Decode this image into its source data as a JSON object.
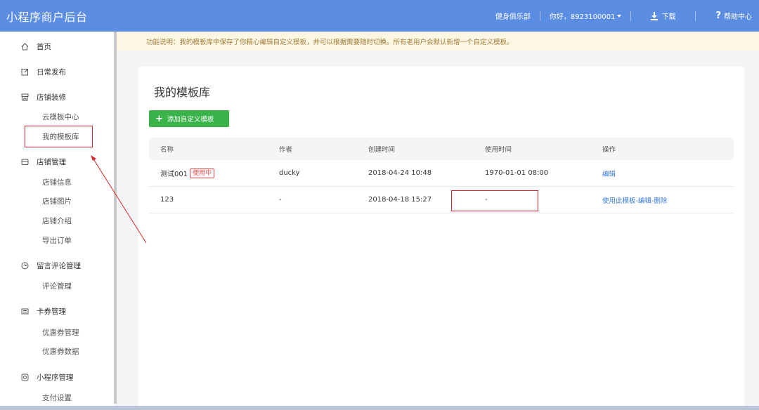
{
  "header": {
    "brand": "小程序商户后台",
    "shop_name": "健身俱乐部",
    "greeting": "你好，8923100001",
    "download": "下载",
    "help": "帮助中心"
  },
  "sidebar": {
    "home": "首页",
    "daily_publish": "日常发布",
    "store_decoration": "店铺装修",
    "cloud_templates": "云模板中心",
    "my_templates": "我的模板库",
    "store_management": "店铺管理",
    "store_info": "店铺信息",
    "store_images": "店铺图片",
    "store_intro": "店铺介绍",
    "export_orders": "导出订单",
    "comment_management": "留言评论管理",
    "review_management": "评论管理",
    "coupon_management": "卡券管理",
    "coupon_admin": "优惠券管理",
    "coupon_data": "优惠券数据",
    "miniprogram_management": "小程序管理",
    "payment_settings": "支付设置"
  },
  "notice": "功能说明：我的模板库中保存了你精心编辑自定义模板，并可以根据需要随时切换。所有老用户会默认新增一个自定义模板。",
  "main": {
    "title": "我的模板库",
    "add_button": "添加自定义模板",
    "columns": [
      "名称",
      "作者",
      "创建时间",
      "使用时间",
      "操作"
    ],
    "rows": [
      {
        "name": "测试001",
        "badge": "使用中",
        "author": "ducky",
        "created": "2018-04-24 10:48",
        "used": "1970-01-01 08:00",
        "action": "编辑"
      },
      {
        "name": "123",
        "badge": "",
        "author": "-",
        "created": "2018-04-18 15:27",
        "used": "-",
        "action": "使用此模板-编辑-删除"
      }
    ]
  },
  "colors": {
    "header_bg": "#5b8de3",
    "accent_green": "#3ab44a",
    "link_blue": "#3a7bd5",
    "annotation_red": "#d9262a"
  }
}
